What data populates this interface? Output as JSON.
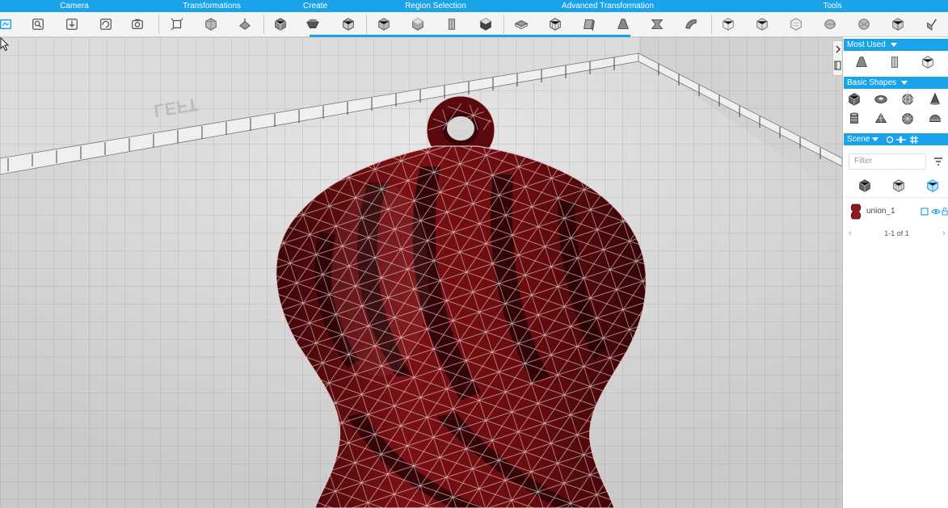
{
  "toolbar": {
    "groups": [
      "Camera",
      "Transformations",
      "Create",
      "Region Selection",
      "Advanced Transformation",
      "Tools"
    ],
    "accent": "#1aa3e8"
  },
  "icons": {
    "camera_tools": [
      "home-view-icon",
      "zoom-fit-icon",
      "frame-selected-icon",
      "orbit-icon",
      "snapshot-icon"
    ],
    "transform_tools": [
      "move-icon",
      "rotate-icon",
      "scale-icon"
    ],
    "create_tools": [
      "add-box-icon",
      "add-shape-icon",
      "add-mesh-icon"
    ],
    "region_tools": [
      "select-region-icon",
      "grow-region-icon",
      "shrink-region-icon",
      "invert-region-icon"
    ],
    "advanced_tools": [
      "extrude-icon",
      "offset-icon",
      "bend-icon",
      "taper-icon",
      "twist-icon",
      "smooth-icon"
    ],
    "tools_tools": [
      "analyze-icon",
      "measure-icon",
      "inspect-icon",
      "repair-icon",
      "hollow-icon",
      "boolean-icon",
      "export-icon"
    ]
  },
  "panel": {
    "most_used": {
      "title": "Most Used"
    },
    "basic_shapes": {
      "title": "Basic Shapes"
    },
    "scene": {
      "title": "Scene",
      "filter_placeholder": "Filter",
      "items": [
        {
          "name": "union_1",
          "color": "#8e1a1e"
        }
      ],
      "pager": "1-1 of 1"
    }
  },
  "model": {
    "color": "#6d0d12",
    "wire_color": "#f0d6d6"
  },
  "viewport": {
    "ruler_text": "LEFT"
  }
}
